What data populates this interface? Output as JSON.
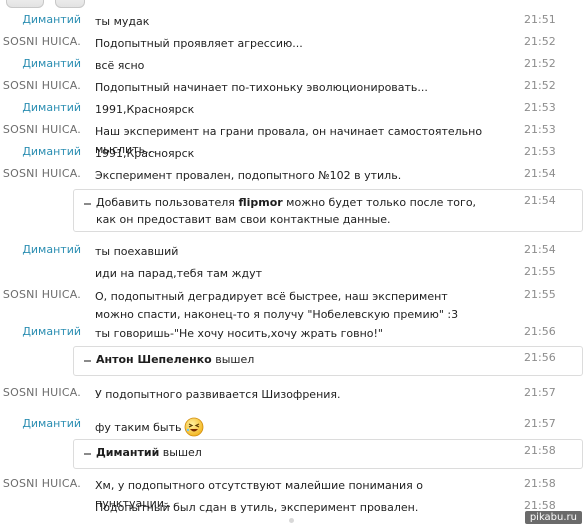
{
  "messages": [
    {
      "sender": "Димантий",
      "text": "ты мудак",
      "time": "21:51"
    },
    {
      "sender": "SOSNI HUICA.",
      "text": "Подопытный проявляет агрессию...",
      "time": "21:52"
    },
    {
      "sender": "Димантий",
      "text": "всё ясно",
      "time": "21:52"
    },
    {
      "sender": "SOSNI HUICA.",
      "text": "Подопытный начинает по-тихоньку эволюционировать...",
      "time": "21:52"
    },
    {
      "sender": "Димантий",
      "text": "1991,Красноярск",
      "time": "21:53"
    },
    {
      "sender": "SOSNI HUICA.",
      "text": "Наш эксперимент на грани провала, он начинает самостоятельно мыслить...",
      "time": "21:53"
    },
    {
      "sender": "Димантий",
      "text": "1991,Красноярск",
      "time": "21:53"
    },
    {
      "sender": "SOSNI HUICA.",
      "text": "Эксперимент провален, подопытного №102 в утиль.",
      "time": "21:54"
    },
    {
      "sender": "Димантий",
      "text": "ты поехавший",
      "time": "21:54"
    },
    {
      "sender": "",
      "text": "иди на парад,тебя там ждут",
      "time": "21:55"
    },
    {
      "sender": "SOSNI HUICA.",
      "text": "О, подопытный деградирует всё быстрее, наш эксперимент можно спасти, наконец-то я получу \"Нобелевскую премию\" :3",
      "time": "21:55"
    },
    {
      "sender": "Димантий",
      "text": "ты говоришь-\"Не хочу носить,хочу жрать говно!\"",
      "time": "21:56"
    },
    {
      "sender": "SOSNI HUICA.",
      "text": "У подопытного развивается Шизофрения.",
      "time": "21:57"
    },
    {
      "sender": "Димантий",
      "text": "фу таким быть",
      "time": "21:57",
      "emoji": "laughing-smiley"
    },
    {
      "sender": "SOSNI HUICA.",
      "text": "Хм, у подопытного отсутствуют малейшие понимания о пунктуации..",
      "time": "21:58"
    },
    {
      "sender": "",
      "text": "Подопытный был сдан в утиль, эксперимент провален.",
      "time": "21:58"
    }
  ],
  "system": [
    {
      "pre": "Добавить пользователя ",
      "bold": "flipmor",
      "post": " можно будет только после того, как он предоставит вам свои контактные данные.",
      "time": "21:54"
    },
    {
      "pre": "",
      "bold": "Антон Шепеленко",
      "post": " вышел",
      "time": "21:56"
    },
    {
      "pre": "",
      "bold": "Димантий",
      "post": " вышел",
      "time": "21:58"
    }
  ],
  "watermark": "pikabu.ru",
  "colors": {
    "sender_dimantiy": "#2b8eb2",
    "sender_sosni": "#6d6d6d",
    "time": "#8c8c8c",
    "system_border": "#dcdcdc"
  }
}
